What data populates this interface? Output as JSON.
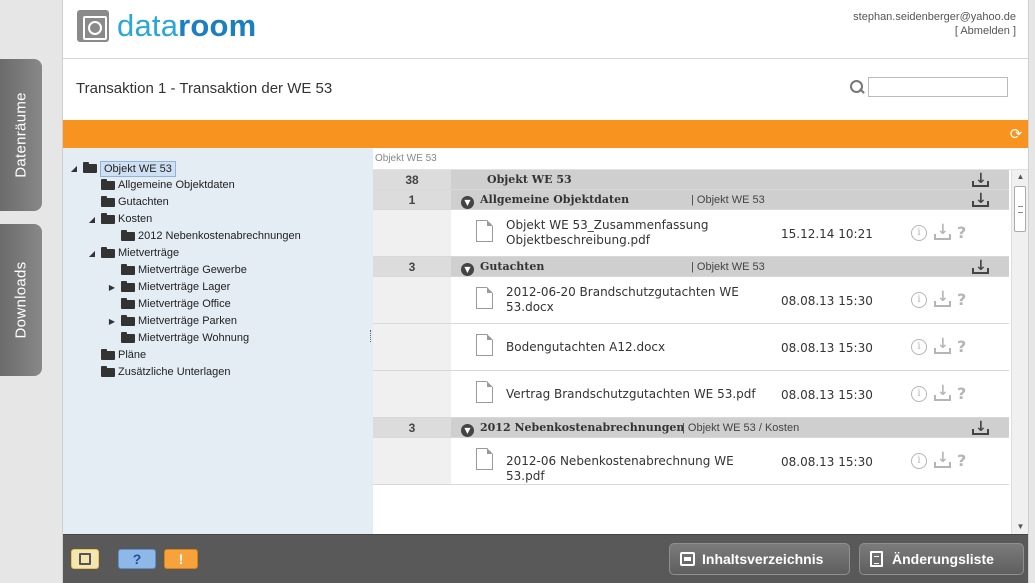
{
  "side_tabs": {
    "datenraeume": "Datenräume",
    "downloads": "Downloads"
  },
  "header": {
    "logo_light": "data",
    "logo_bold": "room",
    "user_email": "stephan.seidenberger@yahoo.de",
    "logout": "[ Abmelden ]"
  },
  "titlebar": {
    "title": "Transaktion 1 - Transaktion der WE 53",
    "search_value": ""
  },
  "tree": {
    "items": [
      {
        "label": "Objekt WE 53"
      },
      {
        "label": "Allgemeine Objektdaten"
      },
      {
        "label": "Gutachten"
      },
      {
        "label": "Kosten"
      },
      {
        "label": "2012 Nebenkostenabrechnungen"
      },
      {
        "label": "Mietverträge"
      },
      {
        "label": "Mietverträge Gewerbe"
      },
      {
        "label": "Mietverträge Lager"
      },
      {
        "label": "Mietverträge Office"
      },
      {
        "label": "Mietverträge Parken"
      },
      {
        "label": "Mietverträge Wohnung"
      },
      {
        "label": "Pläne"
      },
      {
        "label": "Zusätzliche Unterlagen"
      }
    ]
  },
  "docs": {
    "breadcrumb": "Objekt WE 53",
    "groups": [
      {
        "count": "38",
        "title": "Objekt WE 53",
        "path": ""
      },
      {
        "count": "1",
        "title": "Allgemeine Objektdaten",
        "path": "| Objekt WE 53"
      },
      {
        "count": "3",
        "title": "Gutachten",
        "path": "| Objekt WE 53"
      },
      {
        "count": "3",
        "title": "2012 Nebenkostenabrechnungen",
        "path": "| Objekt WE 53 / Kosten"
      }
    ],
    "files": [
      {
        "name": "Objekt WE 53_Zusammenfassung Objektbeschreibung.pdf",
        "date": "15.12.14 10:21"
      },
      {
        "name": "2012-06-20 Brandschutzgutachten WE 53.docx",
        "date": "08.08.13 15:30"
      },
      {
        "name": "Bodengutachten A12.docx",
        "date": "08.08.13 15:30"
      },
      {
        "name": "Vertrag Brandschutzgutachten WE 53.pdf",
        "date": "08.08.13 15:30"
      },
      {
        "name": "2012-06 Nebenkostenabrechnung WE 53.pdf",
        "date": "08.08.13 15:30"
      }
    ]
  },
  "footer": {
    "help": "?",
    "warn": "!",
    "toc": "Inhaltsverzeichnis",
    "changes": "Änderungsliste"
  },
  "colors": {
    "accent_orange": "#f7931e",
    "logo_blue": "#29a7d9",
    "tree_bg": "#e4ecf4",
    "footer_bg": "#595959"
  }
}
